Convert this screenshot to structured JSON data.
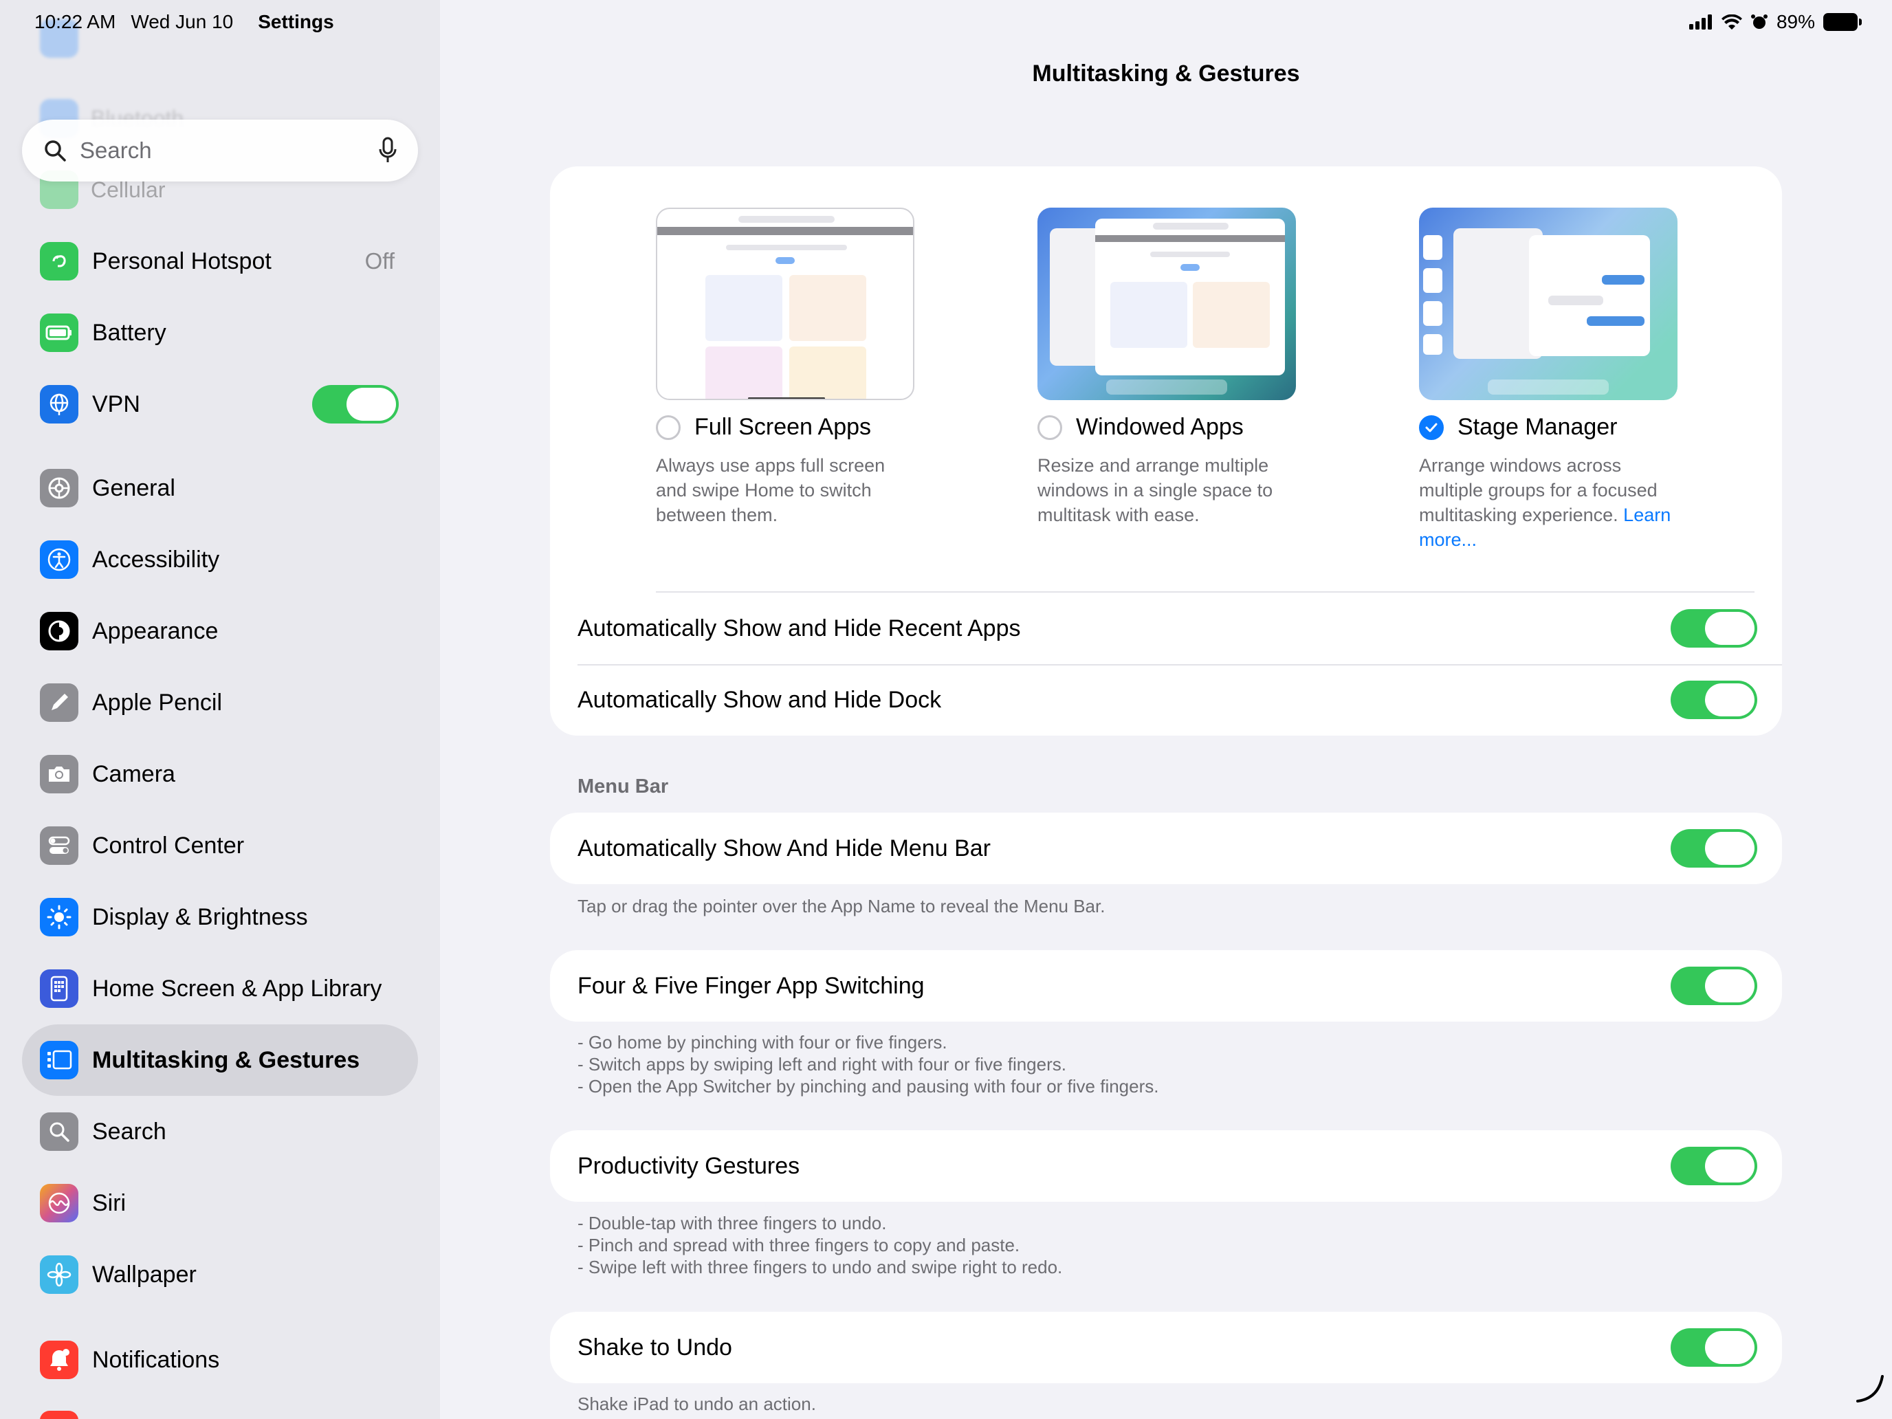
{
  "status_bar": {
    "time": "10:22 AM",
    "date": "Wed Jun 10",
    "app": "Settings",
    "battery": "89%"
  },
  "sidebar": {
    "search_placeholder": "Search",
    "faded_items": [
      "Bluetooth",
      "Cellular"
    ],
    "items": [
      {
        "label": "Personal Hotspot",
        "value": "Off",
        "icon": "hotspot-icon",
        "color": "#34c759"
      },
      {
        "label": "Battery",
        "icon": "battery-icon",
        "color": "#34c759"
      },
      {
        "label": "VPN",
        "icon": "vpn-globe-icon",
        "color": "#1a73e8",
        "toggle": true
      },
      {
        "label": "General",
        "icon": "gear-icon",
        "color": "#8e8e93"
      },
      {
        "label": "Accessibility",
        "icon": "accessibility-icon",
        "color": "#0a7aff"
      },
      {
        "label": "Appearance",
        "icon": "appearance-icon",
        "color": "#000000"
      },
      {
        "label": "Apple Pencil",
        "icon": "pencil-icon",
        "color": "#8e8e93"
      },
      {
        "label": "Camera",
        "icon": "camera-icon",
        "color": "#8e8e93"
      },
      {
        "label": "Control Center",
        "icon": "control-center-icon",
        "color": "#8e8e93"
      },
      {
        "label": "Display & Brightness",
        "icon": "brightness-icon",
        "color": "#0a7aff"
      },
      {
        "label": "Home Screen & App Library",
        "icon": "home-screen-icon",
        "color": "#3b5bdb"
      },
      {
        "label": "Multitasking & Gestures",
        "icon": "multitasking-icon",
        "color": "#0a7aff",
        "selected": true
      },
      {
        "label": "Search",
        "icon": "search-icon",
        "color": "#8e8e93"
      },
      {
        "label": "Siri",
        "icon": "siri-icon",
        "color": "#d4578c"
      },
      {
        "label": "Wallpaper",
        "icon": "wallpaper-icon",
        "color": "#3fb8e8"
      },
      {
        "label": "Notifications",
        "icon": "bell-icon",
        "color": "#ff3b30"
      }
    ]
  },
  "main": {
    "title": "Multitasking & Gestures",
    "modes": [
      {
        "title": "Full Screen Apps",
        "desc": "Always use apps full screen and swipe Home to switch between them.",
        "checked": false
      },
      {
        "title": "Windowed Apps",
        "desc": "Resize and arrange multiple windows in a single space to multitask with ease.",
        "checked": false
      },
      {
        "title": "Stage Manager",
        "desc": "Arrange windows across multiple groups for a focused multitasking experience.",
        "link": "Learn more...",
        "checked": true
      }
    ],
    "rows_card1": [
      {
        "label": "Automatically Show and Hide Recent Apps",
        "on": true
      },
      {
        "label": "Automatically Show and Hide Dock",
        "on": true
      }
    ],
    "menu_bar_header": "Menu Bar",
    "menu_bar_row": {
      "label": "Automatically Show And Hide Menu Bar",
      "on": true
    },
    "menu_bar_footnote": "Tap or drag the pointer over the App Name to reveal the Menu Bar.",
    "four_finger_row": {
      "label": "Four & Five Finger App Switching",
      "on": true
    },
    "four_finger_footnote": [
      "- Go home by pinching with four or five fingers.",
      "- Switch apps by swiping left and right with four or five fingers.",
      "- Open the App Switcher by pinching and pausing with four or five fingers."
    ],
    "productivity_row": {
      "label": "Productivity Gestures",
      "on": true
    },
    "productivity_footnote": [
      "- Double-tap with three fingers to undo.",
      "- Pinch and spread with three fingers to copy and paste.",
      "- Swipe left with three fingers to undo and swipe right to redo."
    ],
    "shake_row": {
      "label": "Shake to Undo",
      "on": true
    },
    "shake_footnote": "Shake iPad to undo an action."
  }
}
